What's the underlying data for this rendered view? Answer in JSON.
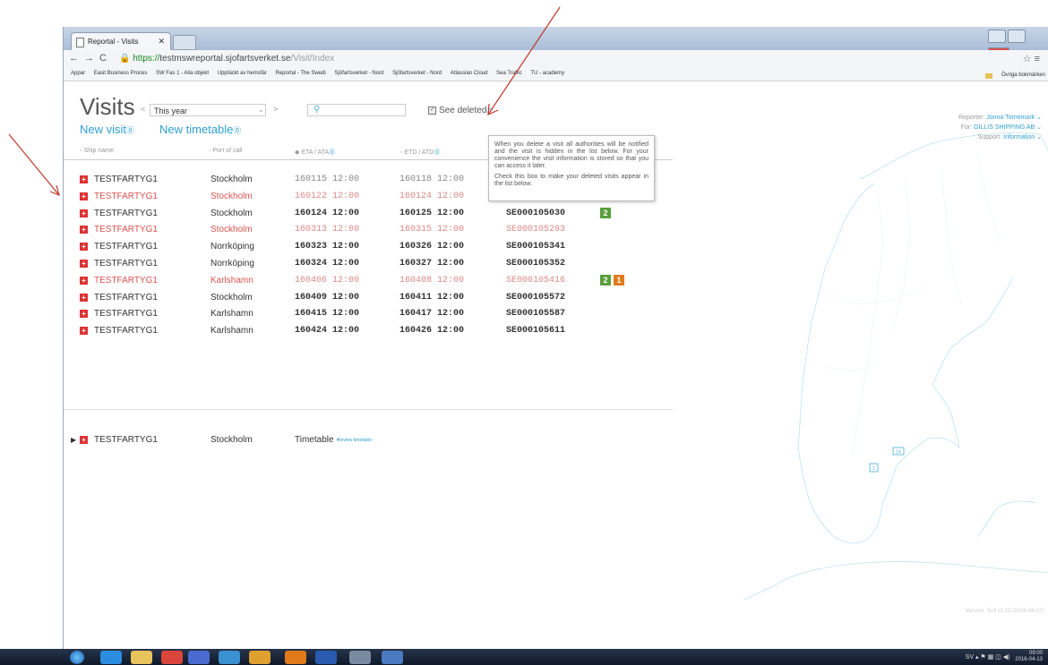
{
  "browser": {
    "tab_title": "Reportal - Visits",
    "url_scheme": "https://",
    "url_host": "testmswreportal.sjofartsverket.se",
    "url_path": "/Visit/Index",
    "bookmarks": [
      "Appar",
      "Easit Business Proces",
      "SW Fas 1 - Alla objekt",
      "Upptäckt av hemsfär",
      "Reportal - The Swedi",
      "Sjöfartsverket - Nord",
      "Sjöfartsverket - Nord",
      "Atlassian Cloud",
      "Sea Traffic",
      "TU - academy"
    ],
    "other_bookmarks": "Övriga bokmärken"
  },
  "page": {
    "title": "Visits",
    "period_selected": "This year",
    "see_deleted_label": "See deleted",
    "new_visit_label": "New visit",
    "new_timetable_label": "New timetable",
    "help_glyph": "⓪",
    "reporter_label": "Reporter:",
    "reporter_value": "Jonna Tornemark",
    "for_label": "For:",
    "for_value": "GILLIS SHIPPING AB",
    "support_label": "Support:",
    "support_value": "Information",
    "version": "Version: Test v1.12 (2016-04-07)"
  },
  "table": {
    "headers": {
      "ship": "Ship name",
      "port": "Port of call",
      "eta": "ETA / ATA",
      "etd": "ETD / ATD"
    },
    "rows": [
      {
        "ship": "TESTFARTYG1",
        "port": "Stockholm",
        "eta": "160115 12:00",
        "etd": "160118 12:00",
        "ref": "",
        "status": "grey",
        "badges": []
      },
      {
        "ship": "TESTFARTYG1",
        "port": "Stockholm",
        "eta": "160122 12:00",
        "etd": "160124 12:00",
        "ref": "",
        "status": "del",
        "badges": []
      },
      {
        "ship": "TESTFARTYG1",
        "port": "Stockholm",
        "eta": "160124 12:00",
        "etd": "160125 12:00",
        "ref": "SE000105030",
        "status": "norm",
        "badges": [
          "2"
        ]
      },
      {
        "ship": "TESTFARTYG1",
        "port": "Stockholm",
        "eta": "160313 12:00",
        "etd": "160315 12:00",
        "ref": "SE000105293",
        "status": "del",
        "badges": []
      },
      {
        "ship": "TESTFARTYG1",
        "port": "Norrköping",
        "eta": "160323 12:00",
        "etd": "160326 12:00",
        "ref": "SE000105341",
        "status": "norm",
        "badges": []
      },
      {
        "ship": "TESTFARTYG1",
        "port": "Norrköping",
        "eta": "160324 12:00",
        "etd": "160327 12:00",
        "ref": "SE000105352",
        "status": "norm",
        "badges": []
      },
      {
        "ship": "TESTFARTYG1",
        "port": "Karlshamn",
        "eta": "160406 12:00",
        "etd": "160408 12:00",
        "ref": "SE000105416",
        "status": "del",
        "badges": [
          "2",
          "1"
        ]
      },
      {
        "ship": "TESTFARTYG1",
        "port": "Stockholm",
        "eta": "160409 12:00",
        "etd": "160411 12:00",
        "ref": "SE000105572",
        "status": "norm",
        "badges": []
      },
      {
        "ship": "TESTFARTYG1",
        "port": "Karlshamn",
        "eta": "160415 12:00",
        "etd": "160417 12:00",
        "ref": "SE000105587",
        "status": "norm",
        "badges": []
      },
      {
        "ship": "TESTFARTYG1",
        "port": "Karlshamn",
        "eta": "160424 12:00",
        "etd": "160426 12:00",
        "ref": "SE000105611",
        "status": "norm",
        "badges": []
      }
    ]
  },
  "tooltip": {
    "p1": "When you delete a visit all authorities will be notified and the visit is hidden in the list below. For your convenience the visit information is stored so that you can access it later.",
    "p2": "Check this box to make your deleted visits appear in the list below."
  },
  "timetable_row": {
    "ship": "TESTFARTYG1",
    "port": "Stockholm",
    "label": "Timetable -",
    "review_link": "Review timetable"
  },
  "map": {
    "markers": [
      "14",
      "2"
    ]
  },
  "taskbar": {
    "lang": "SV",
    "time": "09:00",
    "date": "2016-04-13"
  },
  "colors": {
    "accent": "#2f9fd0",
    "deleted": "#d9534f",
    "badge_green": "#5a9e3c",
    "badge_orange": "#e07b1a",
    "annotation_arrow": "#c0392b"
  }
}
